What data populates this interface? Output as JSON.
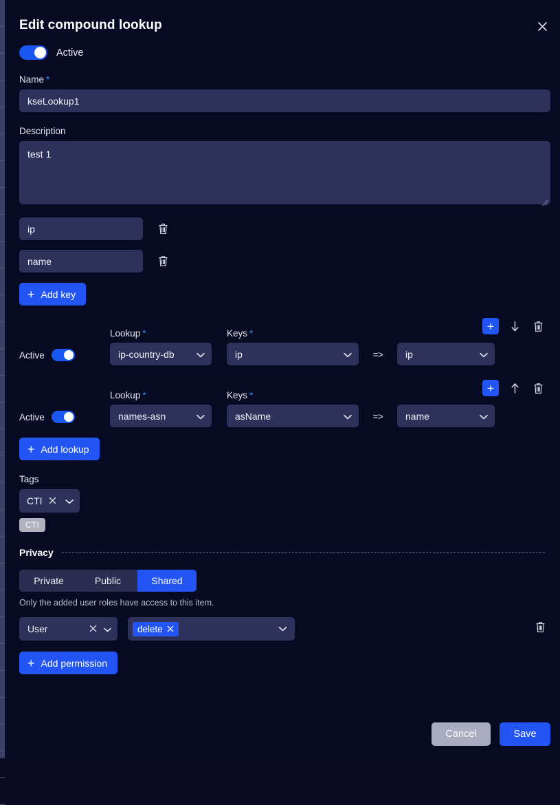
{
  "modal": {
    "title": "Edit compound lookup",
    "close_icon": "close-icon"
  },
  "active_toggle": {
    "label": "Active",
    "state": "on"
  },
  "name_field": {
    "label": "Name",
    "required_mark": "*",
    "value": "kseLookup1"
  },
  "description_field": {
    "label": "Description",
    "value": "test 1"
  },
  "keys": [
    {
      "value": "ip",
      "delete_icon": "trash-icon"
    },
    {
      "value": "name",
      "delete_icon": "trash-icon"
    }
  ],
  "add_key_button": {
    "label": "Add key",
    "plus": "+"
  },
  "lookups": {
    "labels": {
      "active": "Active",
      "lookup": "Lookup",
      "keys": "Keys",
      "required_mark": "*",
      "maps_to": "=>"
    },
    "rows": [
      {
        "active": "on",
        "lookup": "ip-country-db",
        "key": "ip",
        "target": "ip",
        "add_icon": "plus-icon",
        "move_icon": "arrow-down-icon",
        "delete_icon": "trash-icon"
      },
      {
        "active": "on",
        "lookup": "names-asn",
        "key": "asName",
        "target": "name",
        "add_icon": "plus-icon",
        "move_icon": "arrow-up-icon",
        "delete_icon": "trash-icon"
      }
    ]
  },
  "add_lookup_button": {
    "label": "Add lookup",
    "plus": "+"
  },
  "tags": {
    "label": "Tags",
    "selected": "CTI",
    "remove_icon": "close-icon",
    "chevron_icon": "chevron-down-icon",
    "badge": "CTI"
  },
  "privacy": {
    "section_title": "Privacy",
    "options": [
      "Private",
      "Public",
      "Shared"
    ],
    "selected": "Shared",
    "hint": "Only the added user roles have access to this item.",
    "permission": {
      "role": "User",
      "role_remove_icon": "close-icon",
      "role_chevron_icon": "chevron-down-icon",
      "actions": [
        "delete"
      ],
      "action_remove_icon": "close-icon",
      "actions_chevron_icon": "chevron-down-icon",
      "delete_icon": "trash-icon"
    },
    "add_permission_button": {
      "label": "Add permission",
      "plus": "+"
    }
  },
  "footer": {
    "cancel_label": "Cancel",
    "save_label": "Save"
  },
  "colors": {
    "accent_blue": "#2355f5",
    "modal_bg": "#060a23",
    "input_bg": "#2e3159",
    "cancel_gray": "#a9abc0",
    "badge_gray": "#b2b2bf"
  }
}
